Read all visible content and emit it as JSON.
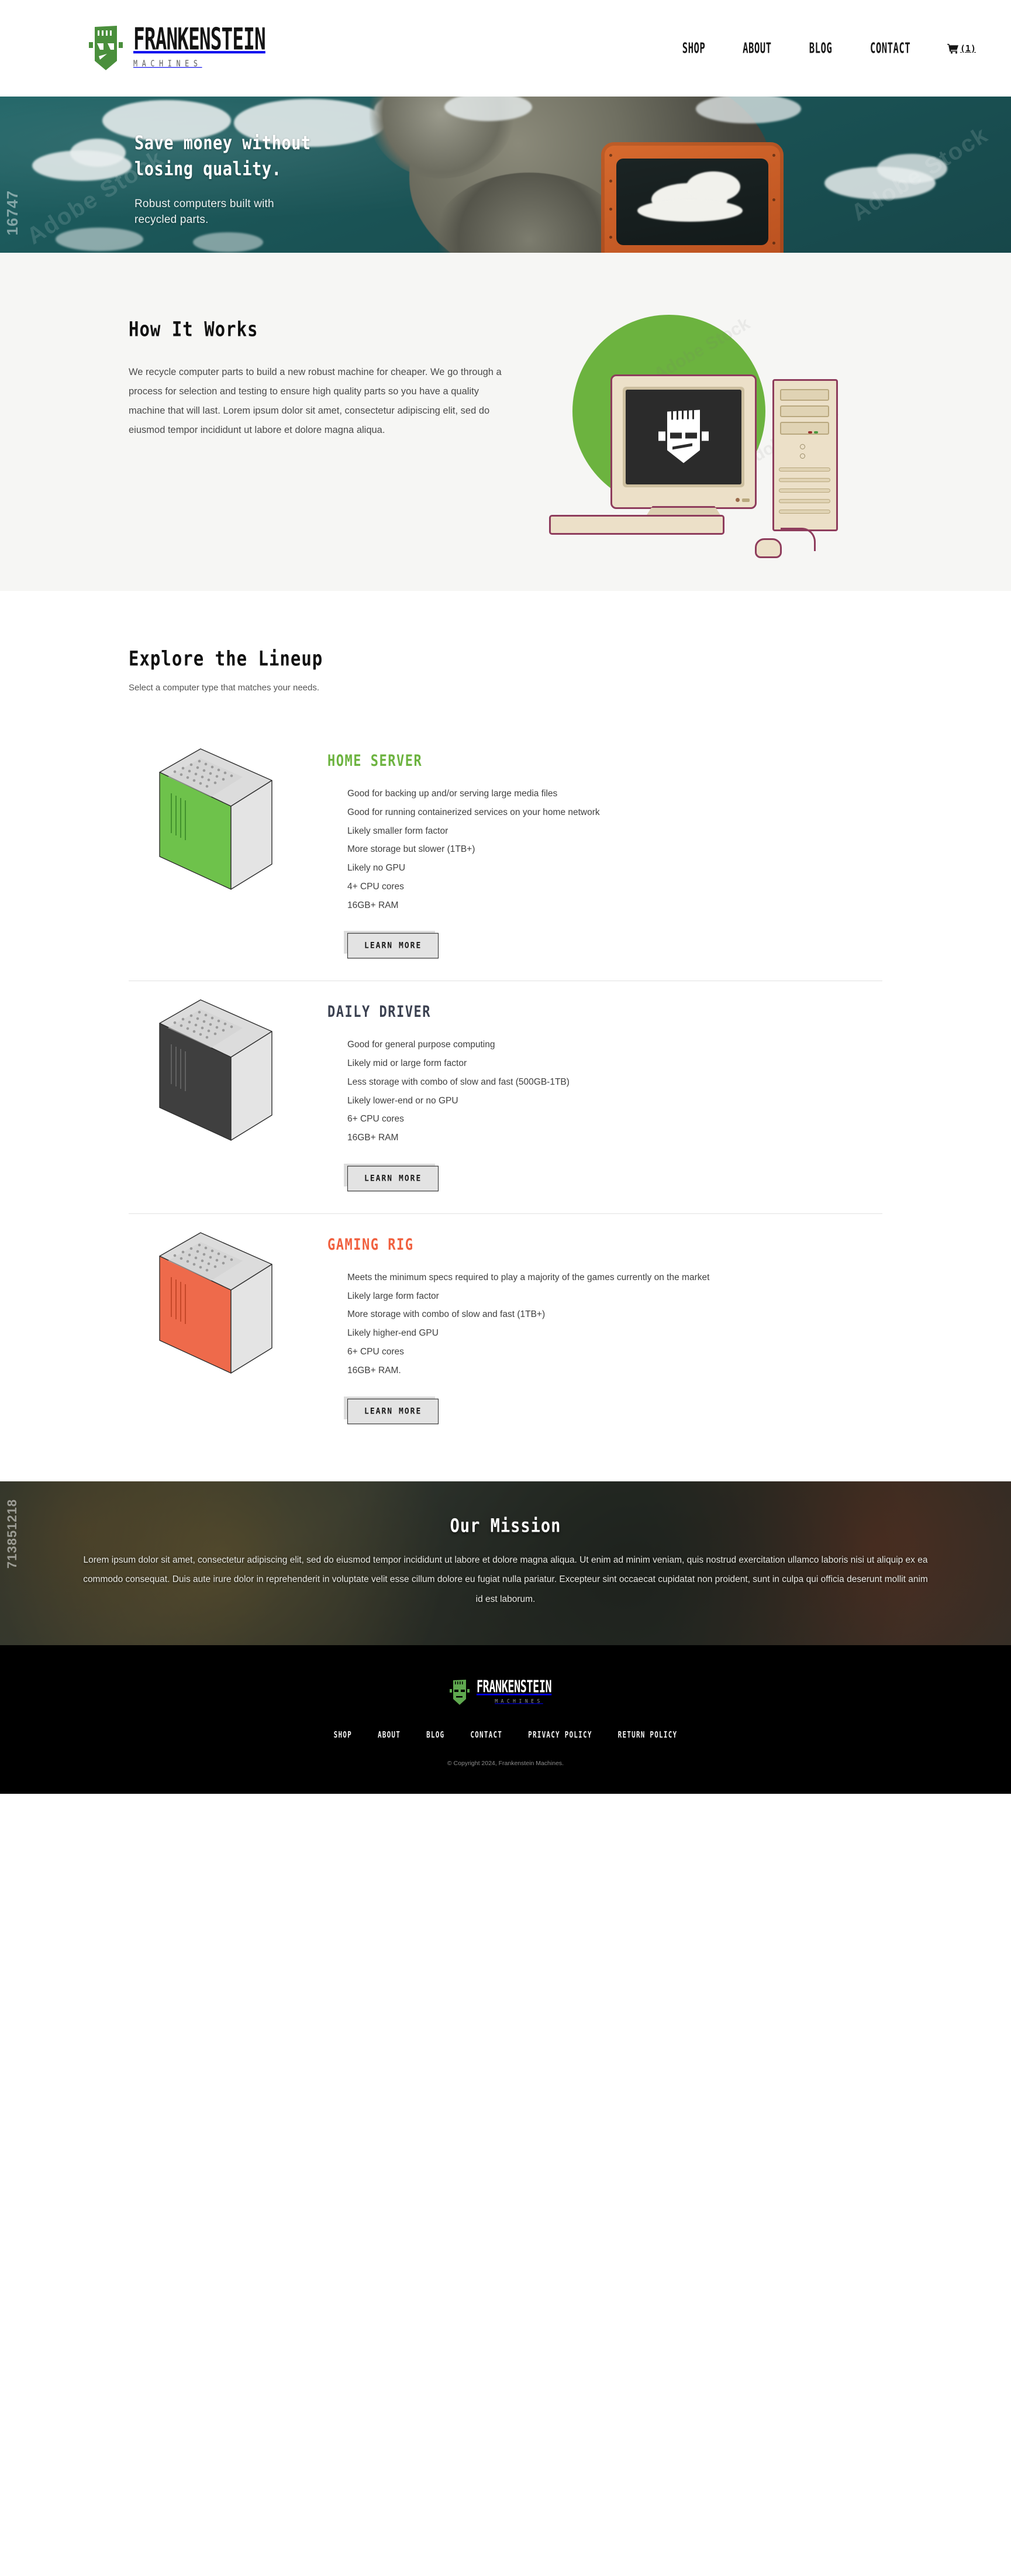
{
  "brand": {
    "name": "FRANKENSTEIN",
    "sub": "MACHINES",
    "logo_icon": "frankenstein-head-icon",
    "green": "#57a14a",
    "footer_green": "#5fa84f"
  },
  "header": {
    "nav": [
      {
        "label": "SHOP",
        "name": "nav-shop"
      },
      {
        "label": "ABOUT",
        "name": "nav-about"
      },
      {
        "label": "BLOG",
        "name": "nav-blog"
      },
      {
        "label": "CONTACT",
        "name": "nav-contact"
      }
    ],
    "cart": {
      "icon": "shopping-cart-icon",
      "count_label": "(1)"
    }
  },
  "hero": {
    "title_line1": "Save money without",
    "title_line2": "losing quality.",
    "subtitle_line1": "Robust computers built with",
    "subtitle_line2": "recycled parts.",
    "watermark_side": "16747",
    "watermark_diag": "Adobe Stock"
  },
  "how_it_works": {
    "title": "How It Works",
    "body": "We recycle computer parts to build a new robust machine for cheaper. We go through a process for selection and testing to ensure high quality parts so you have a quality machine that will last. Lorem ipsum dolor sit amet, consectetur adipiscing elit, sed do eiusmod tempor incididunt ut labore et dolore magna aliqua.",
    "illustration": "retro-desktop-computer-illustration",
    "circle_color": "#6cb33f",
    "watermark": "Adobe Stock"
  },
  "lineup": {
    "title": "Explore the Lineup",
    "subtitle": "Select a computer type that matches your needs.",
    "products": [
      {
        "name": "HOME SERVER",
        "color": "#6cb33f",
        "case_color": "#6ec24b",
        "icon": "pc-tower-green-icon",
        "specs": [
          "Good for backing up and/or serving large media files",
          "Good for running containerized services on your home network",
          "Likely smaller form factor",
          "More storage but slower (1TB+)",
          "Likely no GPU",
          "4+ CPU cores",
          "16GB+ RAM"
        ],
        "button": "LEARN MORE"
      },
      {
        "name": "DAILY DRIVER",
        "color": "#3b4151",
        "case_color": "#3f3f3f",
        "icon": "pc-tower-gray-icon",
        "specs": [
          "Good for general purpose computing",
          "Likely mid or large form factor",
          "Less storage with combo of slow and fast (500GB-1TB)",
          "Likely lower-end or no GPU",
          "6+ CPU cores",
          "16GB+ RAM"
        ],
        "button": "LEARN MORE"
      },
      {
        "name": "GAMING RIG",
        "color": "#f1603f",
        "case_color": "#ee6a4b",
        "icon": "pc-tower-orange-icon",
        "specs": [
          "Meets the minimum specs required to play a majority of the games currently on the market",
          "Likely large form factor",
          "More storage with combo of slow and fast (1TB+)",
          "Likely higher-end GPU",
          "6+ CPU cores",
          "16GB+ RAM."
        ],
        "button": "LEARN MORE"
      }
    ]
  },
  "mission": {
    "title": "Our Mission",
    "body": "Lorem ipsum dolor sit amet, consectetur adipiscing elit, sed do eiusmod tempor incididunt ut labore et dolore magna aliqua. Ut enim ad minim veniam, quis nostrud exercitation ullamco laboris nisi ut aliquip ex ea commodo consequat. Duis aute irure dolor in reprehenderit in voluptate velit esse cillum dolore eu fugiat nulla pariatur. Excepteur sint occaecat cupidatat non proident, sunt in culpa qui officia deserunt mollit anim id est laborum.",
    "watermark_side": "713851218"
  },
  "footer": {
    "nav": [
      {
        "label": "SHOP",
        "name": "footer-link-shop"
      },
      {
        "label": "ABOUT",
        "name": "footer-link-about"
      },
      {
        "label": "BLOG",
        "name": "footer-link-blog"
      },
      {
        "label": "CONTACT",
        "name": "footer-link-contact"
      },
      {
        "label": "PRIVACY POLICY",
        "name": "footer-link-privacy-policy"
      },
      {
        "label": "RETURN POLICY",
        "name": "footer-link-return-policy"
      }
    ],
    "copyright": "© Copyright 2024, Frankenstein Machines."
  }
}
